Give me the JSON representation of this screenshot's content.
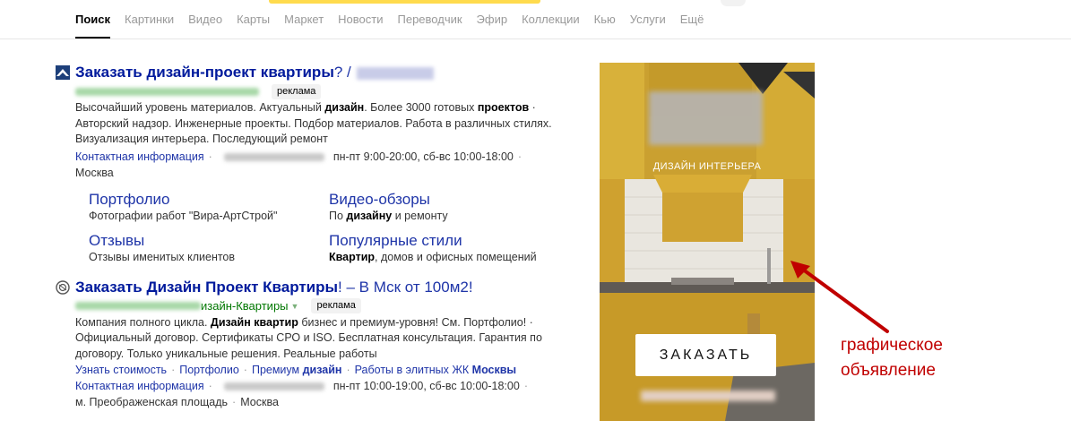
{
  "tabs": [
    {
      "label": "Поиск"
    },
    {
      "label": "Картинки"
    },
    {
      "label": "Видео"
    },
    {
      "label": "Карты"
    },
    {
      "label": "Маркет"
    },
    {
      "label": "Новости"
    },
    {
      "label": "Переводчик"
    },
    {
      "label": "Эфир"
    },
    {
      "label": "Коллекции"
    },
    {
      "label": "Кью"
    },
    {
      "label": "Услуги"
    },
    {
      "label": "Ещё"
    }
  ],
  "result1": {
    "title_bold": "Заказать дизайн-проект квартиры",
    "title_tail": "? /",
    "ad_label": "реклама",
    "snippet": {
      "p1": "Высочайший уровень материалов. Актуальный ",
      "b1": "дизайн",
      "p2": ". Более 3000 готовых ",
      "b2": "проектов",
      "p3": " · Авторский надзор. Инженерные проекты. Подбор материалов. Работа в различных стилях. Визуализация интерьера. Последующий ремонт"
    },
    "contact_link": "Контактная информация",
    "hours": "пн-пт 9:00-20:00, сб-вс 10:00-18:00",
    "city": "Москва",
    "sitelinks": [
      {
        "title": "Портфолио",
        "desc": "Фотографии работ \"Вира-АртСтрой\""
      },
      {
        "title": "Видео-обзоры",
        "desc_pre": "По ",
        "desc_bold": "дизайну",
        "desc_post": " и ремонту"
      },
      {
        "title": "Отзывы",
        "desc": "Отзывы именитых клиентов"
      },
      {
        "title": "Популярные стили",
        "desc_bold": "Квартир",
        "desc_post": ", домов и офисных помещений"
      }
    ]
  },
  "result2": {
    "title_bold": "Заказать Дизайн Проект Квартиры",
    "title_tail": "! – В Мск от 100м2!",
    "url_visible": "изайн-Квартиры",
    "ad_label": "реклама",
    "snippet": {
      "p1": "Компания полного цикла. ",
      "b1": "Дизайн квартир",
      "p2": " бизнес и премиум-уровня! См. Портфолио! · Официальный договор. Сертификаты СРО и ISO. Бесплатная консультация. Гарантия по договору. Только уникальные решения. Реальные работы"
    },
    "quicklinks": {
      "l1": "Узнать стоимость",
      "l2": "Портфолио",
      "l3_pre": "Премиум ",
      "l3_bold": "дизайн",
      "l4_pre": "Работы в элитных ЖК ",
      "l4_bold": "Москвы"
    },
    "contact_link": "Контактная информация",
    "hours": "пн-пт 10:00-19:00, сб-вс 10:00-18:00",
    "address": "м. Преображенская площадь",
    "city": "Москва"
  },
  "banner": {
    "subtitle": "ДИЗАЙН ИНТЕРЬЕРА",
    "button_label": "ЗАКАЗАТЬ"
  },
  "annotation": {
    "line1": "графическое",
    "line2": "объявление"
  },
  "colors": {
    "link": "#1f35a8",
    "title": "#001a9c",
    "annotation": "#c00000",
    "search_accent": "#ffdb4d"
  }
}
